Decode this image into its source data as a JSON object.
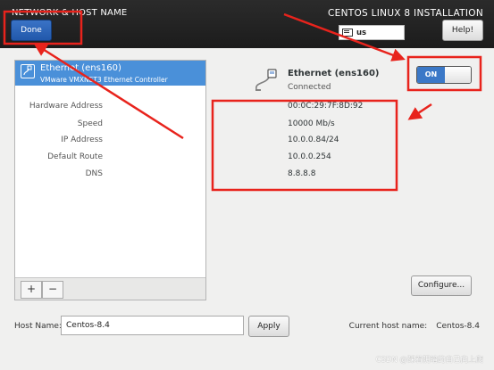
{
  "header": {
    "title": "NETWORK & HOST NAME",
    "done_label": "Done",
    "install_title": "CENTOS LINUX 8 INSTALLATION",
    "keyboard_layout": "us",
    "help_label": "Help!"
  },
  "devices": [
    {
      "name": "Ethernet (ens160)",
      "description": "VMware VMXNET3 Ethernet Controller"
    }
  ],
  "list_toolbar": {
    "add_label": "+",
    "remove_label": "−"
  },
  "selected_device": {
    "name": "Ethernet (ens160)",
    "status": "Connected",
    "toggle_label": "ON",
    "toggle_on": true,
    "details": [
      {
        "label": "Hardware Address",
        "value": "00:0C:29:7F:8D:92"
      },
      {
        "label": "Speed",
        "value": "10000 Mb/s"
      },
      {
        "label": "IP Address",
        "value": "10.0.0.84/24"
      },
      {
        "label": "Default Route",
        "value": "10.0.0.254"
      },
      {
        "label": "DNS",
        "value": "8.8.8.8"
      }
    ],
    "configure_label": "Configure..."
  },
  "hostname": {
    "label": "Host Name:",
    "value": "Centos-8.4",
    "apply_label": "Apply",
    "current_label": "Current host name:",
    "current_value": "Centos-8.4"
  },
  "watermark": "CSDN @踩着阴暗的自己向上爬",
  "colors": {
    "header_bg": "#1c1c1c",
    "accent": "#3b78c7",
    "selection": "#4a90d9",
    "annotation_red": "#e8231c"
  }
}
